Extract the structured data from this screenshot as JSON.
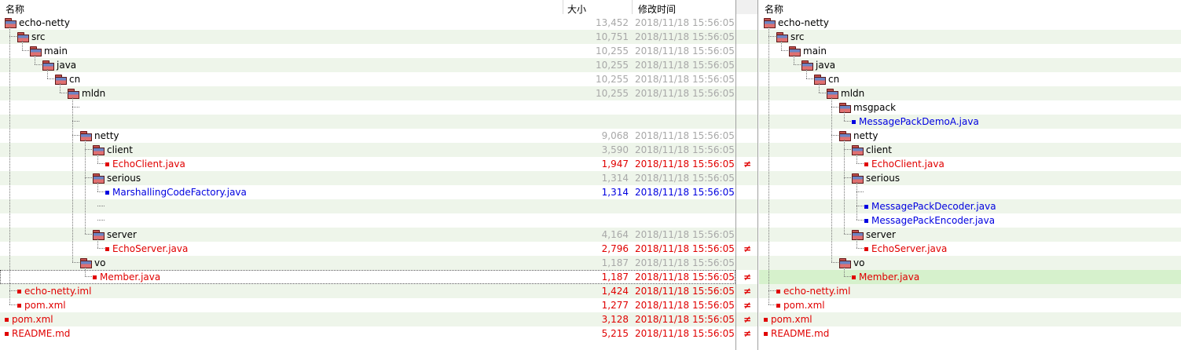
{
  "header": {
    "name_label": "名称",
    "size_label": "大小",
    "modified_label": "修改时间",
    "right_name_label": "名称"
  },
  "colors": {
    "alt_row": "#eef5ea",
    "selected_row": "#d6f1cc",
    "diff_red": "#e00000",
    "only_blue": "#0000e0"
  },
  "neq_symbol": "≠",
  "left_rows": [
    {
      "name": "echo-netty",
      "type": "folder",
      "depth": 0,
      "size": "13,452",
      "date": "2018/11/18 15:56:05",
      "status": "gray"
    },
    {
      "name": "src",
      "type": "folder",
      "depth": 1,
      "size": "10,751",
      "date": "2018/11/18 15:56:05",
      "status": "gray"
    },
    {
      "name": "main",
      "type": "folder",
      "depth": 2,
      "size": "10,255",
      "date": "2018/11/18 15:56:05",
      "status": "gray"
    },
    {
      "name": "java",
      "type": "folder",
      "depth": 3,
      "size": "10,255",
      "date": "2018/11/18 15:56:05",
      "status": "gray"
    },
    {
      "name": "cn",
      "type": "folder",
      "depth": 4,
      "size": "10,255",
      "date": "2018/11/18 15:56:05",
      "status": "gray"
    },
    {
      "name": "mldn",
      "type": "folder",
      "depth": 5,
      "size": "10,255",
      "date": "2018/11/18 15:56:05",
      "status": "gray"
    },
    {
      "name": "",
      "type": "empty",
      "depth": 6,
      "size": "",
      "date": "",
      "status": ""
    },
    {
      "name": "",
      "type": "empty",
      "depth": 6,
      "size": "",
      "date": "",
      "status": ""
    },
    {
      "name": "netty",
      "type": "folder",
      "depth": 6,
      "size": "9,068",
      "date": "2018/11/18 15:56:05",
      "status": "gray"
    },
    {
      "name": "client",
      "type": "folder",
      "depth": 7,
      "size": "3,590",
      "date": "2018/11/18 15:56:05",
      "status": "gray"
    },
    {
      "name": "EchoClient.java",
      "type": "file",
      "depth": 8,
      "size": "1,947",
      "date": "2018/11/18 15:56:05",
      "status": "red",
      "neq": true
    },
    {
      "name": "serious",
      "type": "folder",
      "depth": 7,
      "size": "1,314",
      "date": "2018/11/18 15:56:05",
      "status": "gray"
    },
    {
      "name": "MarshallingCodeFactory.java",
      "type": "file",
      "depth": 8,
      "size": "1,314",
      "date": "2018/11/18 15:56:05",
      "status": "blue"
    },
    {
      "name": "",
      "type": "empty",
      "depth": 8,
      "size": "",
      "date": "",
      "status": ""
    },
    {
      "name": "",
      "type": "empty",
      "depth": 8,
      "size": "",
      "date": "",
      "status": ""
    },
    {
      "name": "server",
      "type": "folder",
      "depth": 7,
      "size": "4,164",
      "date": "2018/11/18 15:56:05",
      "status": "gray"
    },
    {
      "name": "EchoServer.java",
      "type": "file",
      "depth": 8,
      "size": "2,796",
      "date": "2018/11/18 15:56:05",
      "status": "red",
      "neq": true
    },
    {
      "name": "vo",
      "type": "folder",
      "depth": 6,
      "size": "1,187",
      "date": "2018/11/18 15:56:05",
      "status": "gray"
    },
    {
      "name": "Member.java",
      "type": "file",
      "depth": 7,
      "size": "1,187",
      "date": "2018/11/18 15:56:05",
      "status": "red",
      "neq": true,
      "focus": true
    },
    {
      "name": "echo-netty.iml",
      "type": "file",
      "depth": 1,
      "size": "1,424",
      "date": "2018/11/18 15:56:05",
      "status": "red",
      "neq": true
    },
    {
      "name": "pom.xml",
      "type": "file",
      "depth": 1,
      "size": "1,277",
      "date": "2018/11/18 15:56:05",
      "status": "red",
      "neq": true
    },
    {
      "name": "pom.xml",
      "type": "file",
      "depth": 0,
      "size": "3,128",
      "date": "2018/11/18 15:56:05",
      "status": "red",
      "neq": true
    },
    {
      "name": "README.md",
      "type": "file",
      "depth": 0,
      "size": "5,215",
      "date": "2018/11/18 15:56:05",
      "status": "red",
      "neq": true
    }
  ],
  "right_rows": [
    {
      "name": "echo-netty",
      "type": "folder",
      "depth": 0,
      "status": "black"
    },
    {
      "name": "src",
      "type": "folder",
      "depth": 1,
      "status": "black"
    },
    {
      "name": "main",
      "type": "folder",
      "depth": 2,
      "status": "black"
    },
    {
      "name": "java",
      "type": "folder",
      "depth": 3,
      "status": "black"
    },
    {
      "name": "cn",
      "type": "folder",
      "depth": 4,
      "status": "black"
    },
    {
      "name": "mldn",
      "type": "folder",
      "depth": 5,
      "status": "black"
    },
    {
      "name": "msgpack",
      "type": "folder",
      "depth": 6,
      "status": "black"
    },
    {
      "name": "MessagePackDemoA.java",
      "type": "file",
      "depth": 7,
      "status": "blue"
    },
    {
      "name": "netty",
      "type": "folder",
      "depth": 6,
      "status": "black"
    },
    {
      "name": "client",
      "type": "folder",
      "depth": 7,
      "status": "black"
    },
    {
      "name": "EchoClient.java",
      "type": "file",
      "depth": 8,
      "status": "red"
    },
    {
      "name": "serious",
      "type": "folder",
      "depth": 7,
      "status": "black"
    },
    {
      "name": "",
      "type": "empty",
      "depth": 8,
      "status": ""
    },
    {
      "name": "MessagePackDecoder.java",
      "type": "file",
      "depth": 8,
      "status": "blue"
    },
    {
      "name": "MessagePackEncoder.java",
      "type": "file",
      "depth": 8,
      "status": "blue"
    },
    {
      "name": "server",
      "type": "folder",
      "depth": 7,
      "status": "black"
    },
    {
      "name": "EchoServer.java",
      "type": "file",
      "depth": 8,
      "status": "red"
    },
    {
      "name": "vo",
      "type": "folder",
      "depth": 6,
      "status": "black"
    },
    {
      "name": "Member.java",
      "type": "file",
      "depth": 7,
      "status": "red",
      "selected": true
    },
    {
      "name": "echo-netty.iml",
      "type": "file",
      "depth": 1,
      "status": "red"
    },
    {
      "name": "pom.xml",
      "type": "file",
      "depth": 1,
      "status": "red"
    },
    {
      "name": "pom.xml",
      "type": "file",
      "depth": 0,
      "status": "red"
    },
    {
      "name": "README.md",
      "type": "file",
      "depth": 0,
      "status": "red"
    }
  ]
}
